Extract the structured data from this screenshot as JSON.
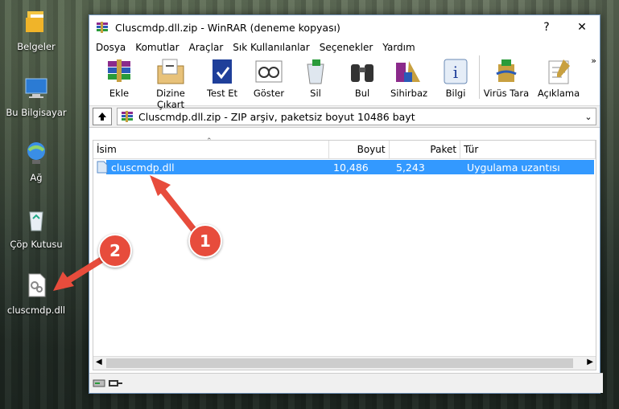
{
  "desktop": {
    "icons": [
      {
        "label": "Belgeler",
        "icon": "folder-icon"
      },
      {
        "label": "Bu Bilgisayar",
        "icon": "computer-icon"
      },
      {
        "label": "Ağ",
        "icon": "network-icon"
      },
      {
        "label": "Çöp Kutusu",
        "icon": "recycle-bin-icon"
      },
      {
        "label": "cluscmdp.dll",
        "icon": "dll-file-icon"
      }
    ]
  },
  "window": {
    "title": "Cluscmdp.dll.zip - WinRAR (deneme kopyası)",
    "help_glyph": "?",
    "close_glyph": "✕"
  },
  "menu": [
    "Dosya",
    "Komutlar",
    "Araçlar",
    "Sık Kullanılanlar",
    "Seçenekler",
    "Yardım"
  ],
  "toolbar": {
    "items": [
      "Ekle",
      "Dizine Çıkart",
      "Test Et",
      "Göster",
      "Sil",
      "Bul",
      "Sihirbaz",
      "Bilgi",
      "Virüs Tara",
      "Açıklama"
    ],
    "more_glyph": "»"
  },
  "address": {
    "text": "Cluscmdp.dll.zip - ZIP arşiv, paketsiz boyut 10486 bayt"
  },
  "columns": [
    "İsim",
    "Boyut",
    "Paket",
    "Tür"
  ],
  "files": [
    {
      "name": "cluscmdp.dll",
      "size": "10,486",
      "packed": "5,243",
      "type": "Uygulama uzantısı"
    }
  ],
  "annotations": [
    "1",
    "2"
  ],
  "colors": {
    "selection": "#3399ff",
    "badge": "#e74c3c",
    "arrow": "#e74c3c"
  }
}
